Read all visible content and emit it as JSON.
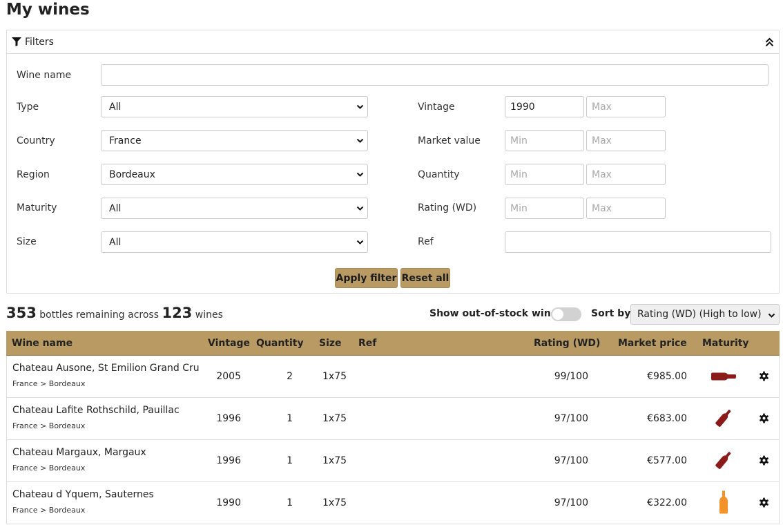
{
  "page": {
    "title": "My wines"
  },
  "filters": {
    "header": "Filters",
    "wine_name": {
      "label": "Wine name",
      "value": "",
      "placeholder": ""
    },
    "type": {
      "label": "Type",
      "selected": "All"
    },
    "country": {
      "label": "Country",
      "selected": "France"
    },
    "region": {
      "label": "Region",
      "selected": "Bordeaux"
    },
    "maturity": {
      "label": "Maturity",
      "selected": "All"
    },
    "size": {
      "label": "Size",
      "selected": "All"
    },
    "vintage": {
      "label": "Vintage",
      "min_value": "1990",
      "min_placeholder": "Min",
      "max_value": "",
      "max_placeholder": "Max"
    },
    "market_value": {
      "label": "Market value",
      "min_value": "",
      "min_placeholder": "Min",
      "max_value": "",
      "max_placeholder": "Max"
    },
    "quantity": {
      "label": "Quantity",
      "min_value": "",
      "min_placeholder": "Min",
      "max_value": "",
      "max_placeholder": "Max"
    },
    "rating": {
      "label": "Rating (WD)",
      "min_value": "",
      "min_placeholder": "Min",
      "max_value": "",
      "max_placeholder": "Max"
    },
    "ref": {
      "label": "Ref",
      "value": ""
    },
    "apply_label": "Apply filter",
    "reset_label": "Reset all"
  },
  "summary": {
    "bottles": "353",
    "bottles_text": "bottles remaining across",
    "wines": "123",
    "wines_text": "wines"
  },
  "controls": {
    "out_of_stock_label": "Show out-of-stock wines",
    "out_of_stock_on": false,
    "sort_label": "Sort by",
    "sort_selected": "Rating (WD) (High to low)"
  },
  "table": {
    "headers": {
      "name": "Wine name",
      "vintage": "Vintage",
      "quantity": "Quantity",
      "size": "Size",
      "ref": "Ref",
      "rating": "Rating (WD)",
      "market_price": "Market price",
      "maturity": "Maturity"
    },
    "rows": [
      {
        "name": "Chateau Ausone, St Emilion Grand Cru",
        "region": "France > Bordeaux",
        "vintage": "2005",
        "quantity": "2",
        "size": "1x75",
        "ref": "",
        "rating": "99/100",
        "price": "€985.00",
        "maturity_icon": "bottle-lying-icon"
      },
      {
        "name": "Chateau Lafite Rothschild, Pauillac",
        "region": "France > Bordeaux",
        "vintage": "1996",
        "quantity": "1",
        "size": "1x75",
        "ref": "",
        "rating": "97/100",
        "price": "€683.00",
        "maturity_icon": "bottle-tilted-icon"
      },
      {
        "name": "Chateau Margaux, Margaux",
        "region": "France > Bordeaux",
        "vintage": "1996",
        "quantity": "1",
        "size": "1x75",
        "ref": "",
        "rating": "97/100",
        "price": "€577.00",
        "maturity_icon": "bottle-tilted-icon"
      },
      {
        "name": "Chateau d Yquem, Sauternes",
        "region": "France > Bordeaux",
        "vintage": "1990",
        "quantity": "1",
        "size": "1x75",
        "ref": "",
        "rating": "97/100",
        "price": "€322.00",
        "maturity_icon": "bottle-upright-icon"
      }
    ]
  },
  "colors": {
    "accent": "#b89a62",
    "red_wine": "#8b1a1a",
    "white_wine": "#f2922a"
  }
}
